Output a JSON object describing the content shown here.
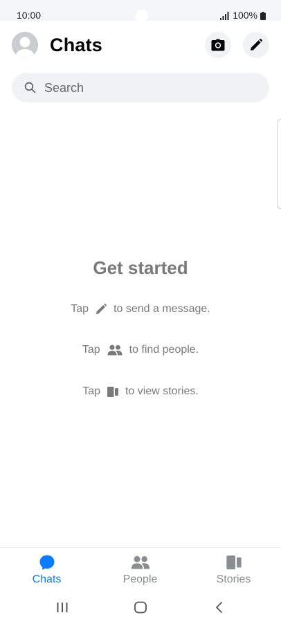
{
  "status_bar": {
    "time": "10:00",
    "battery": "100%"
  },
  "header": {
    "title": "Chats",
    "camera_icon": "camera-icon",
    "compose_icon": "pencil-icon"
  },
  "search": {
    "placeholder": "Search"
  },
  "empty_state": {
    "title": "Get started",
    "hints": [
      {
        "before": "Tap",
        "icon": "pencil-icon",
        "after": "to send a message."
      },
      {
        "before": "Tap",
        "icon": "people-icon",
        "after": "to find people."
      },
      {
        "before": "Tap",
        "icon": "stories-icon",
        "after": "to view stories."
      }
    ]
  },
  "bottom_nav": {
    "items": [
      {
        "label": "Chats",
        "icon": "chat-bubble-icon",
        "active": true
      },
      {
        "label": "People",
        "icon": "people-icon",
        "active": false
      },
      {
        "label": "Stories",
        "icon": "stories-icon",
        "active": false
      }
    ]
  },
  "colors": {
    "accent": "#0a7cff",
    "muted_text": "#7a7a7a",
    "inactive_icon": "#8a8d91",
    "search_bg": "#f0f2f5"
  }
}
